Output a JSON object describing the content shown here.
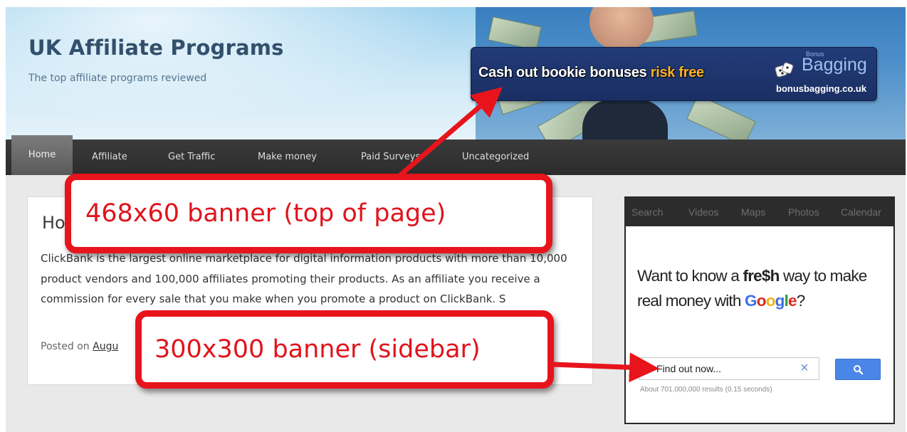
{
  "site": {
    "title": "UK Affiliate Programs",
    "tagline": "The top affiliate programs reviewed"
  },
  "ad_banner": {
    "cta_part1": "Cash out bookie bonuses ",
    "cta_highlight": "risk free",
    "brand_small": "Bonus",
    "brand": "Bagging",
    "domain": "bonusbagging.co.uk",
    "highlight_color": "#ffb12a"
  },
  "nav": {
    "items": [
      {
        "label": "Home",
        "active": true
      },
      {
        "label": "Affiliate"
      },
      {
        "label": "Get Traffic"
      },
      {
        "label": "Make money"
      },
      {
        "label": "Paid Surveys"
      },
      {
        "label": "Uncategorized"
      }
    ]
  },
  "article": {
    "title": "Ho",
    "body": "ClickBank is the largest online marketplace for digital information products with more than 10,000 product vendors and 100,000 affiliates promoting their products. As an affiliate you receive a commission for every sale that you make when you promote a product on ClickBank. S",
    "meta_prefix": "Posted on ",
    "meta_date": "Augu"
  },
  "sidebar": {
    "tabs": [
      "Search",
      "Videos",
      "Maps",
      "Photos",
      "Calendar"
    ],
    "headline_part1": "Want to know a ",
    "headline_bold": "fre$h",
    "headline_part2": " way to make real money with ",
    "headline_part3": "?",
    "google_letters": [
      "G",
      "o",
      "o",
      "g",
      "l",
      "e"
    ],
    "search_placeholder": "Find out now...",
    "clear_icon": "close-icon",
    "search_button_icon": "search-icon",
    "results_text": "About 701,000,000 results (0.15 seconds)"
  },
  "callouts": {
    "top": "468x60 banner (top of page)",
    "side": "300x300 banner (sidebar)",
    "color": "#e8141c"
  }
}
